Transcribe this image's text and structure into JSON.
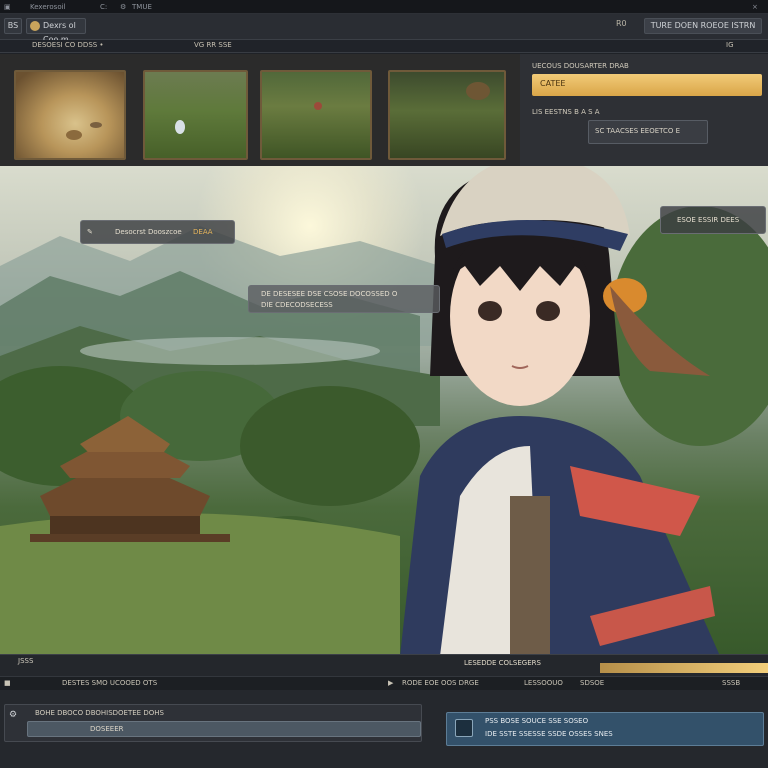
{
  "topbar": {
    "menu1": "Kexerosoil",
    "menu2": "C:",
    "menu3": "TMUE",
    "close": "×"
  },
  "toolbar": {
    "left_btn": "BS",
    "path_text": "Dexrs  ol  Coo  m",
    "mid_label": "R0",
    "right_btn": "TURE  DOEN  ROEOE  ISTRN",
    "right_small": "×"
  },
  "subbar": {
    "left": "DESOESI  CO  DDSS  •",
    "mid": "VG  RR  SSE",
    "right": "IG"
  },
  "right_panel": {
    "title": "UECOUS  DOUSARTER  DRAB",
    "gold_label": "CATEE",
    "sub_label": "LIS  EESTNS  B  A  S  A",
    "field_label": "SC  TAACSES  EEOETCO  E"
  },
  "overlays": {
    "banner1": "Desocrst  Dooszcoe",
    "banner1_badge": "DEAA",
    "banner2_line1": "DE  DESESEE  DSE  CSOSE  DOCOSSED  O",
    "banner2_line2": "DIE  CDECODSECESS",
    "right_chip": "ESOE  ESSIR  DEES"
  },
  "bottom": {
    "bar1_left": "JSSS",
    "bar1_mid": "LESEDDE  COLSEGERS",
    "bar2_left": "DESTES  SMO  UCOOED  OTS",
    "bar2_mid": "RODE  EOE  OOS  DRGE",
    "bar2_right_a": "LESSOOUO",
    "bar2_right_b": "SDSOE",
    "bar2_far": "SSSB",
    "foot_left_title": "BOHE  DBOCO  DBOHISDOETEE  DOHS",
    "foot_left_field": "DOSEEER",
    "foot_right_line1": "PSS  BOSE  SOUCE  SSE  SOSEO",
    "foot_right_line2": "IDE  SSTE  SSESSE  SSDE  OSSES  SNES"
  },
  "colors": {
    "accent_gold": "#e2b25c",
    "panel_blue": "#33516a",
    "frame_brown": "#6f5a3a"
  }
}
